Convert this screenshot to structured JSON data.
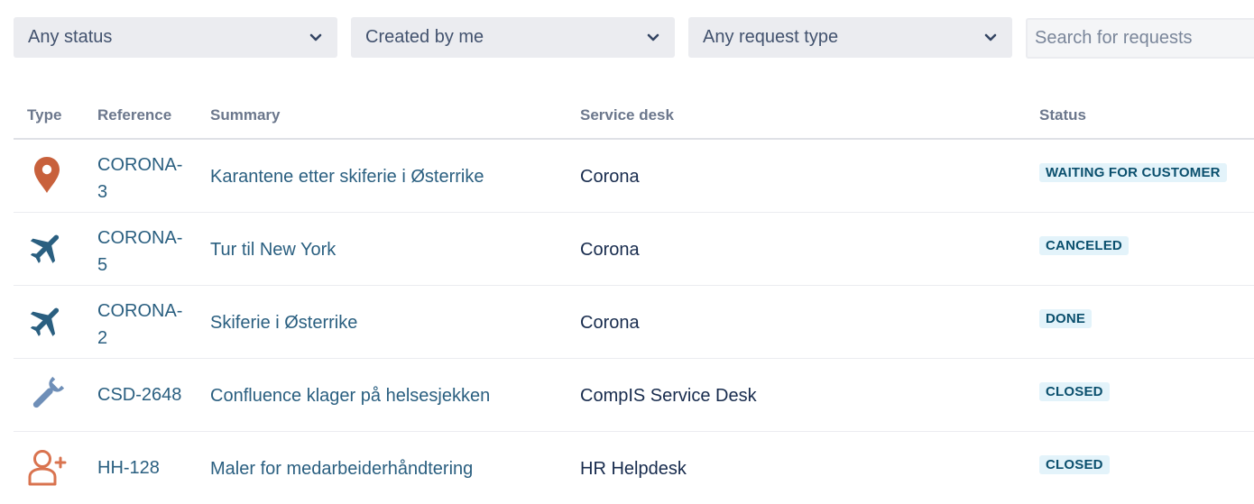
{
  "filters": {
    "status": {
      "label": "Any status"
    },
    "creator": {
      "label": "Created by me"
    },
    "request_type": {
      "label": "Any request type"
    },
    "search": {
      "placeholder": "Search for requests",
      "value": ""
    }
  },
  "table": {
    "headers": {
      "type": "Type",
      "reference": "Reference",
      "summary": "Summary",
      "service_desk": "Service desk",
      "status": "Status"
    },
    "rows": [
      {
        "icon": "location-pin-icon",
        "reference": "CORONA-3",
        "summary": "Karantene etter skiferie i Østerrike",
        "service_desk": "Corona",
        "status": "WAITING FOR CUSTOMER"
      },
      {
        "icon": "airplane-icon",
        "reference": "CORONA-5",
        "summary": "Tur til New York",
        "service_desk": "Corona",
        "status": "CANCELED"
      },
      {
        "icon": "airplane-icon",
        "reference": "CORONA-2",
        "summary": "Skiferie i Østerrike",
        "service_desk": "Corona",
        "status": "DONE"
      },
      {
        "icon": "wrench-icon",
        "reference": "CSD-2648",
        "summary": "Confluence klager på helsesjekken",
        "service_desk": "CompIS Service Desk",
        "status": "CLOSED"
      },
      {
        "icon": "add-user-icon",
        "reference": "HH-128",
        "summary": "Maler for medarbeiderhåndtering",
        "service_desk": "HR Helpdesk",
        "status": "CLOSED"
      }
    ]
  },
  "colors": {
    "link": "#2a5f80",
    "status_badge_bg": "#e3f3fa",
    "status_badge_text": "#0a4f6d",
    "pin_icon": "#c8613c",
    "airplane_icon": "#2a5f80",
    "wrench_icon": "#6f8fb8",
    "user_icon": "#d9734f"
  }
}
